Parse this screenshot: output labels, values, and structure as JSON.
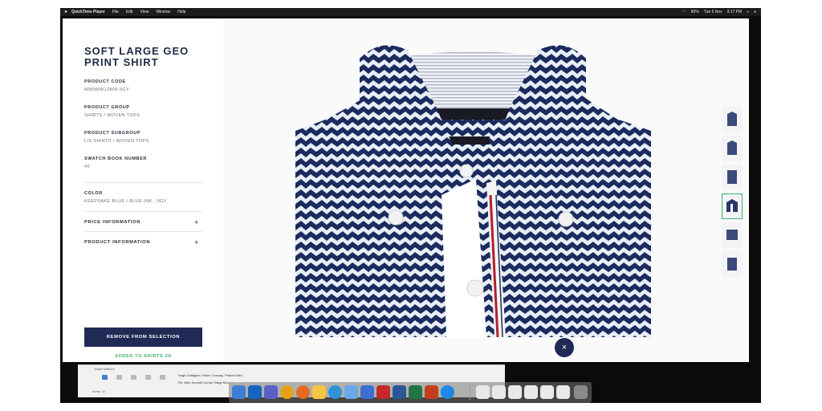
{
  "menubar": {
    "app": "QuickTime Player",
    "items": [
      "File",
      "Edit",
      "View",
      "Window",
      "Help"
    ],
    "status_items": [
      "80%",
      "Tue 5 Nov",
      "9:17 PM"
    ]
  },
  "product": {
    "title": "SOFT LARGE GEO PRINT SHIRT",
    "fields": [
      {
        "label": "PRODUCT CODE",
        "value": "MW0MW12806 0GY"
      },
      {
        "label": "PRODUCT GROUP",
        "value": "SHIRTS / WOVEN TOPS"
      },
      {
        "label": "PRODUCT SUBGROUP",
        "value": "L/S SHIRTS / WOVEN TOPS"
      },
      {
        "label": "SWATCH BOOK NUMBER",
        "value": "40"
      },
      {
        "label": "COLOR",
        "value": "KEEPSAKE BLUE / BLUE INK - 0GY"
      }
    ],
    "expanders": [
      {
        "label": "PRICE INFORMATION",
        "icon": "plus-icon",
        "symbol": "+"
      },
      {
        "label": "PRODUCT INFORMATION",
        "icon": "plus-icon",
        "symbol": "+"
      }
    ],
    "remove_button": "REMOVE FROM SELECTION",
    "added_prefix": "ADDED TO",
    "added_target": "SHIRTS 3D"
  },
  "viewer": {
    "close_symbol": "×",
    "selected_thumbnail": 4,
    "thumbnail_count": 6,
    "shirt_colors": {
      "navy": "#1b2b5e",
      "light": "#e8eef6",
      "white": "#ffffff",
      "red": "#b3202a"
    }
  },
  "mail": {
    "nav": "Smart Mailbox",
    "rows": [
      "Hugh Gallagher, Helen Conway, Pravini Nath...",
      "Re: Web Summit Centre Stage Mod..."
    ],
    "status": "Items: 10"
  },
  "colors": {
    "accent_navy": "#1f2a55",
    "accent_green": "#38b36a"
  }
}
